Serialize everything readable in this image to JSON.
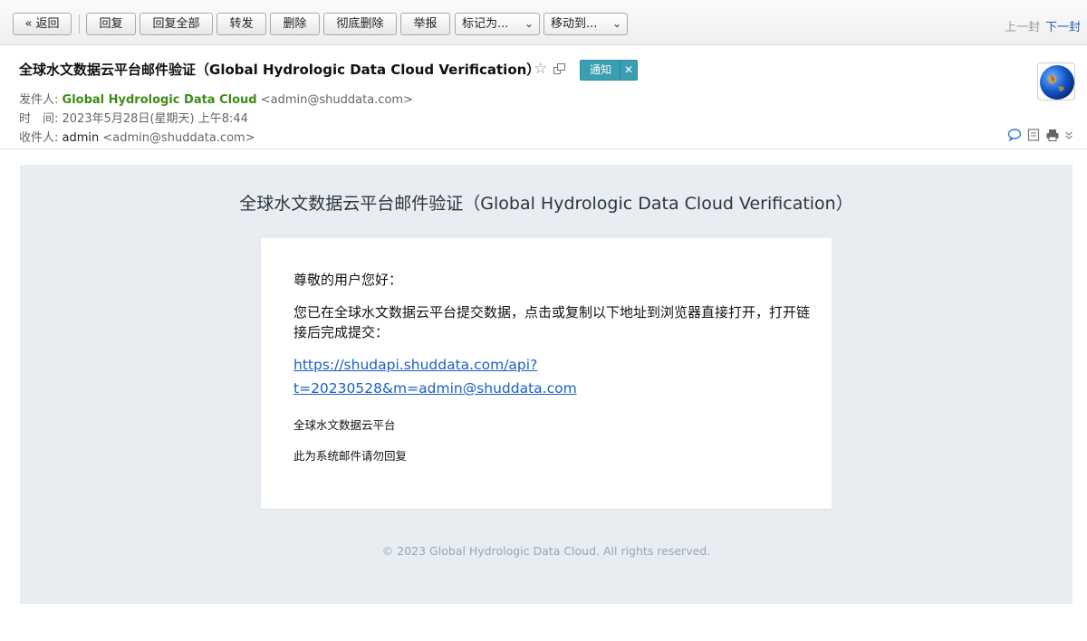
{
  "toolbar": {
    "back": "« 返回",
    "reply": "回复",
    "reply_all": "回复全部",
    "forward": "转发",
    "delete": "删除",
    "delete_permanently": "彻底删除",
    "report": "举报",
    "mark_as": "标记为...",
    "move_to": "移动到...",
    "prev": "上一封",
    "next": "下一封"
  },
  "header": {
    "subject": "全球水文数据云平台邮件验证（Global Hydrologic Data Cloud Verification）",
    "tag": "通知",
    "from_label": "发件人:",
    "from_name": "Global Hydrologic Data Cloud",
    "from_addr": "<admin@shuddata.com>",
    "time_label": "时　间:",
    "time_value": "2023年5月28日(星期天) 上午8:44",
    "to_label": "收件人:",
    "to_name": "admin",
    "to_addr": "<admin@shuddata.com>"
  },
  "email": {
    "title": "全球水文数据云平台邮件验证（Global Hydrologic Data Cloud Verification）",
    "greeting": "尊敬的用户您好：",
    "paragraph": "您已在全球水文数据云平台提交数据，点击或复制以下地址到浏览器直接打开，打开链接后完成提交：",
    "link_line1": "https://shudapi.shuddata.com/api?",
    "link_line2": "t=20230528&m=admin@shuddata.com",
    "signature": "全球水文数据云平台",
    "no_reply": "此为系统邮件请勿回复",
    "footer": "© 2023 Global Hydrologic Data Cloud. All rights reserved."
  },
  "colors": {
    "sender_green": "#3c8c17",
    "link_blue": "#1a5fc7",
    "tag_teal": "#3a9fb3",
    "body_bg": "#e8edf2"
  },
  "icons": [
    "star-icon",
    "popout-icon",
    "close-icon",
    "chevron-down-icon",
    "globe-avatar-icon",
    "chat-icon",
    "note-icon",
    "print-icon",
    "more-chevron-icon"
  ]
}
